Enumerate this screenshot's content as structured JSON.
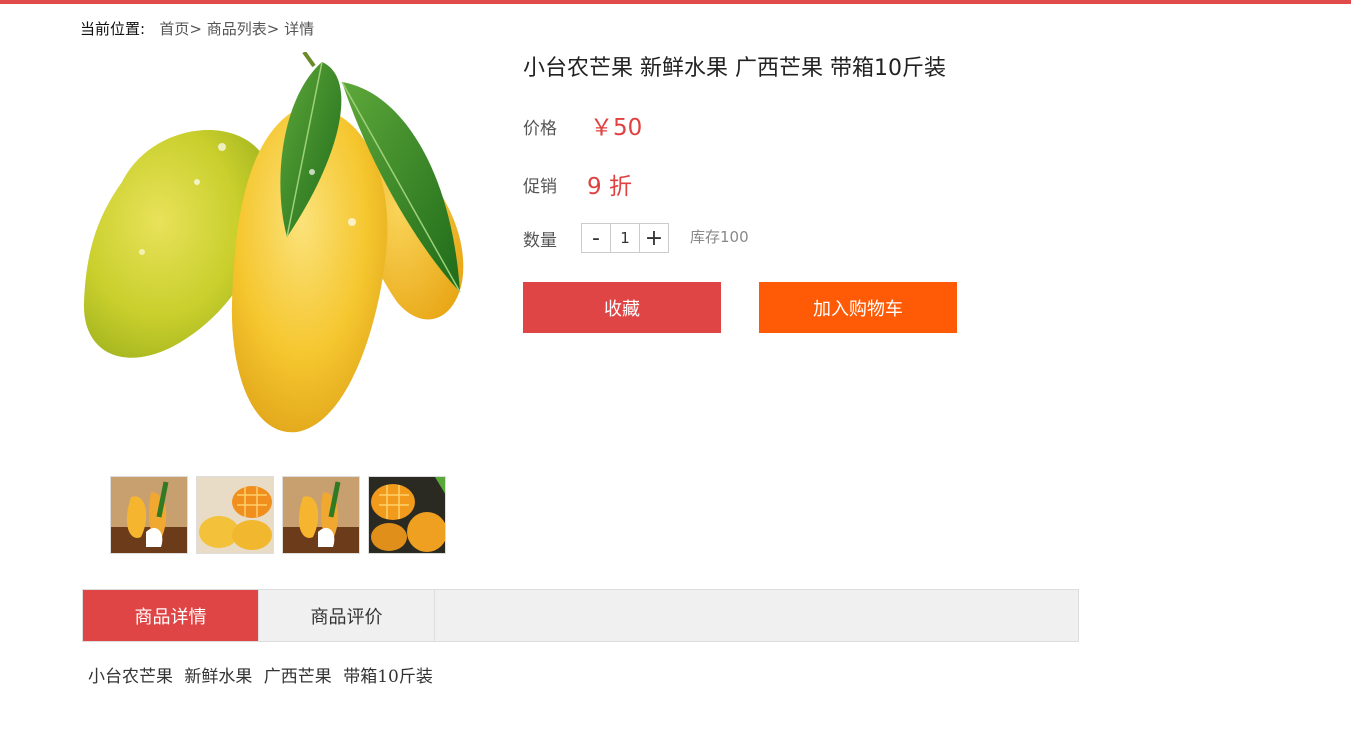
{
  "breadcrumb": {
    "label": "当前位置:",
    "items": [
      {
        "label": "首页"
      },
      {
        "label": "商品列表"
      },
      {
        "label": "详情"
      }
    ],
    "separator": ">"
  },
  "product": {
    "title": "小台农芒果 新鲜水果 广西芒果 带箱10斤装",
    "price_label": "价格",
    "price_value": "￥50",
    "promo_label": "促销",
    "promo_value": "9 折",
    "qty_label": "数量",
    "qty_minus": "-",
    "qty_value": "1",
    "qty_plus": "+",
    "stock": "库存100"
  },
  "actions": {
    "favorite_label": "收藏",
    "cart_label": "加入购物车"
  },
  "tabs": [
    {
      "label": "商品详情",
      "active": true
    },
    {
      "label": "商品评价",
      "active": false
    }
  ],
  "detail": {
    "text": "小台农芒果 新鲜水果 广西芒果 带箱10斤装"
  },
  "colors": {
    "accent": "#e04546",
    "cart": "#ff5a05",
    "price": "#e04040"
  }
}
